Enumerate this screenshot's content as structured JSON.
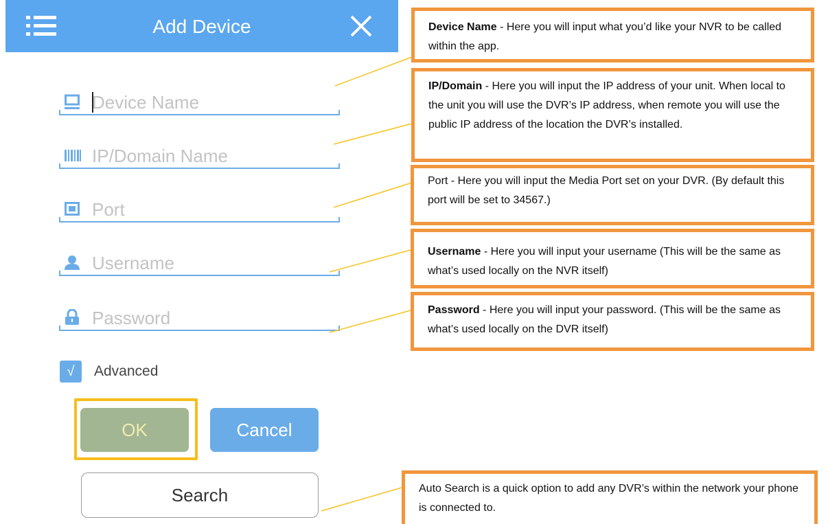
{
  "header": {
    "title": "Add Device",
    "menu_icon": "hamburger-menu-icon",
    "close_icon": "close-icon",
    "background": "#5aa6ef"
  },
  "form": {
    "fields": [
      {
        "name": "device-name",
        "icon": "monitor-icon",
        "placeholder": "Device Name"
      },
      {
        "name": "ip-domain",
        "icon": "barcode-icon",
        "placeholder": "IP/Domain Name"
      },
      {
        "name": "port",
        "icon": "port-icon",
        "placeholder": "Port"
      },
      {
        "name": "username",
        "icon": "user-icon",
        "placeholder": "Username"
      },
      {
        "name": "password",
        "icon": "lock-icon",
        "placeholder": "Password"
      }
    ],
    "advanced": {
      "label": "Advanced",
      "checked": true,
      "check_glyph": "√"
    },
    "buttons": {
      "ok": "OK",
      "cancel": "Cancel",
      "search": "Search"
    },
    "accent": "#6aace8"
  },
  "annotations": {
    "border_color": "#f0963c",
    "highlight_color": "#f7bd1c",
    "device_name": {
      "bold": "Device Name",
      "text": " - Here you will input what you’d like your NVR to be called within the app."
    },
    "ip_domain": {
      "bold": "IP/Domain",
      "text": " - Here you will input the IP address of your unit. When local to the unit you will use the DVR’s IP address, when remote you will use the public IP address of the location the DVR’s installed."
    },
    "port": {
      "text": "Port - Here you will input the Media Port set on your DVR.  (By default this port will be set to 34567.)"
    },
    "username": {
      "bold": "Username",
      "text": " - Here you will input your username (This will be the same as what’s used locally on the NVR itself)"
    },
    "password": {
      "bold": "Password",
      "text": " - Here you will input your password. (This will be the same as what’s used locally on the DVR itself)"
    },
    "search": {
      "text": "Auto Search is a quick option to add any DVR’s within the network your phone is connected to."
    }
  }
}
